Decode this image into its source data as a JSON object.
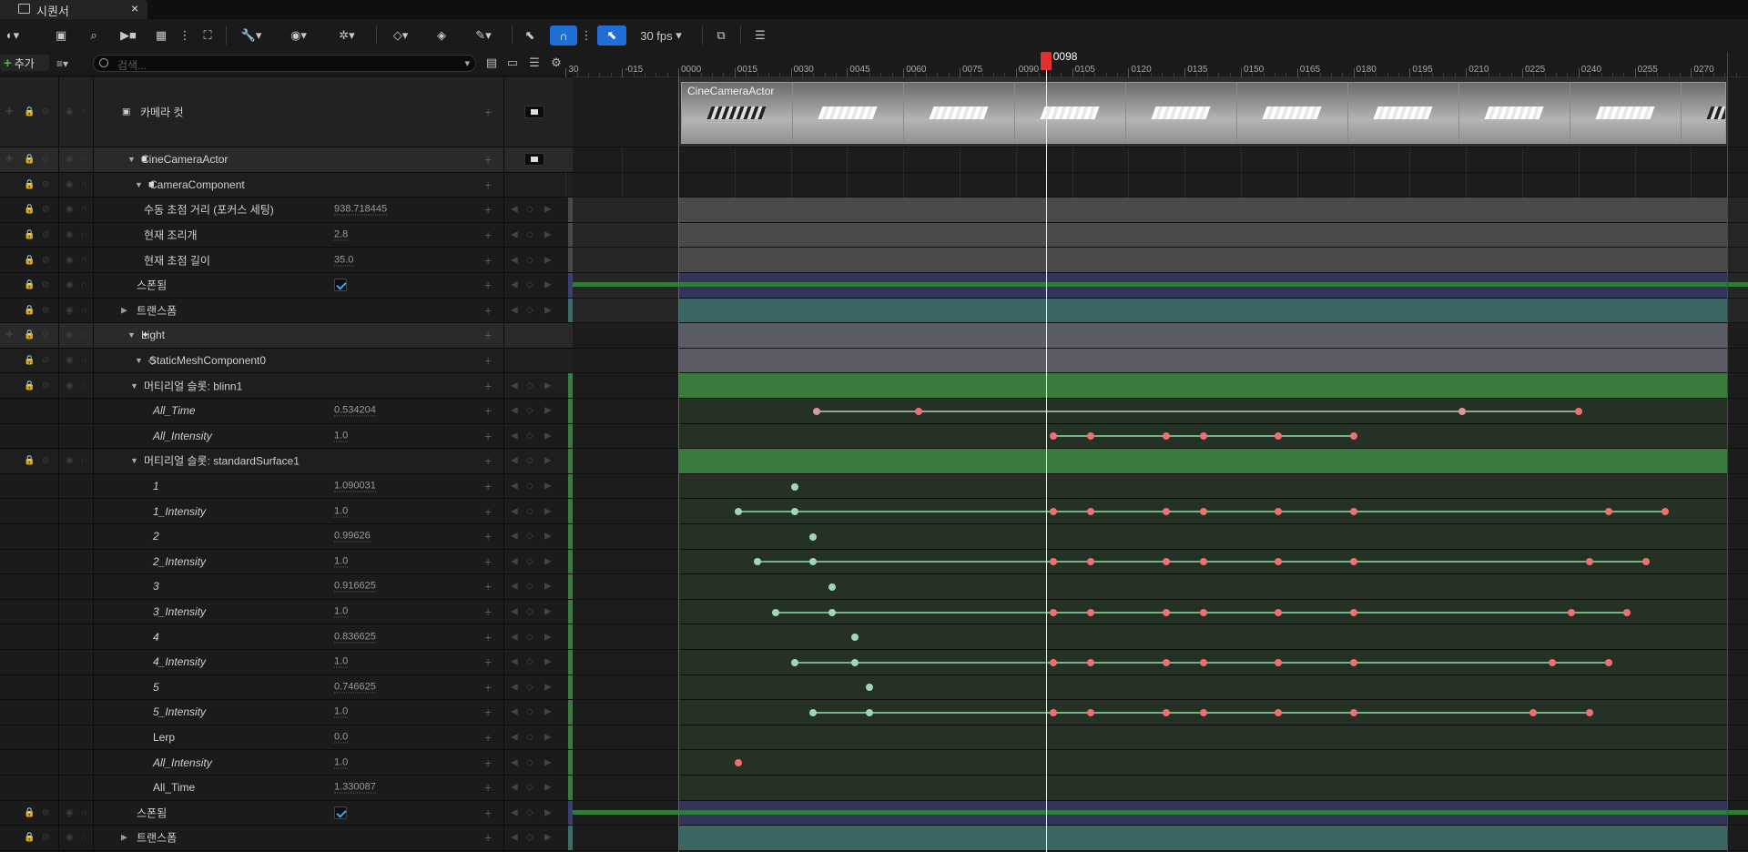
{
  "window": {
    "tab_title": "시퀀서"
  },
  "toolbar": {
    "fps_label": "30 fps"
  },
  "panel": {
    "add_label": "추가",
    "search_placeholder": "검색..."
  },
  "rows": [
    {
      "label": "카메라 컷"
    },
    {
      "label": "CineCameraActor"
    },
    {
      "label": "CameraComponent"
    },
    {
      "label": "수동 초점 거리 (포커스 세팅)",
      "value": "938.718445"
    },
    {
      "label": "현재 조리개",
      "value": "2.8"
    },
    {
      "label": "현재 초점 길이",
      "value": "35.0"
    },
    {
      "label": "스폰됨"
    },
    {
      "label": "트랜스폼"
    },
    {
      "label": "Light"
    },
    {
      "label": "StaticMeshComponent0"
    },
    {
      "label": "머티리얼 슬롯: blinn1"
    },
    {
      "label": "All_Time",
      "value": "0.534204"
    },
    {
      "label": "All_Intensity",
      "value": "1.0"
    },
    {
      "label": "머티리얼 슬롯: standardSurface1"
    },
    {
      "label": "1",
      "value": "1.090031"
    },
    {
      "label": "1_Intensity",
      "value": "1.0"
    },
    {
      "label": "2",
      "value": "0.99626"
    },
    {
      "label": "2_Intensity",
      "value": "1.0"
    },
    {
      "label": "3",
      "value": "0.916625"
    },
    {
      "label": "3_Intensity",
      "value": "1.0"
    },
    {
      "label": "4",
      "value": "0.836625"
    },
    {
      "label": "4_Intensity",
      "value": "1.0"
    },
    {
      "label": "5",
      "value": "0.746625"
    },
    {
      "label": "5_Intensity",
      "value": "1.0"
    },
    {
      "label": "Lerp",
      "value": "0.0"
    },
    {
      "label": "All_Intensity",
      "value": "1.0"
    },
    {
      "label": "All_Time",
      "value": "1.330087"
    },
    {
      "label": "스폰됨"
    },
    {
      "label": "트랜스폼"
    }
  ],
  "timeline": {
    "current_frame": "0098",
    "camera_clip_label": "CineCameraActor",
    "ticks": [
      "30",
      "-015",
      "0000",
      "0015",
      "0030",
      "0045",
      "0060",
      "0075",
      "0090",
      "0105",
      "0120",
      "0135",
      "0150",
      "0165",
      "0180",
      "0195",
      "0210",
      "0225",
      "0240",
      "0255",
      "0270"
    ],
    "keyframes": [
      {
        "row": 11,
        "frames": [
          37,
          64,
          209,
          240
        ]
      },
      {
        "row": 12,
        "frames": [
          100,
          110,
          130,
          140,
          160,
          180
        ]
      },
      {
        "row": 14,
        "frames": [
          31
        ]
      },
      {
        "row": 15,
        "frames": [
          16,
          31,
          100,
          110,
          130,
          140,
          160,
          180,
          248,
          263
        ]
      },
      {
        "row": 16,
        "frames": [
          36
        ]
      },
      {
        "row": 17,
        "frames": [
          21,
          36,
          100,
          110,
          130,
          140,
          160,
          180,
          243,
          258
        ]
      },
      {
        "row": 18,
        "frames": [
          41
        ]
      },
      {
        "row": 19,
        "frames": [
          26,
          41,
          100,
          110,
          130,
          140,
          160,
          180,
          238,
          253
        ]
      },
      {
        "row": 20,
        "frames": [
          47
        ]
      },
      {
        "row": 21,
        "frames": [
          31,
          47,
          100,
          110,
          130,
          140,
          160,
          180,
          233,
          248
        ]
      },
      {
        "row": 22,
        "frames": [
          51
        ]
      },
      {
        "row": 23,
        "frames": [
          36,
          51,
          100,
          110,
          130,
          140,
          160,
          180,
          228,
          243
        ]
      },
      {
        "row": 25,
        "frames": [
          16
        ]
      }
    ]
  },
  "colors": {
    "accent": "#1f6fd6",
    "playhead": "#e03030",
    "key_green": "#9ed8b6",
    "key_red": "#f07070"
  }
}
